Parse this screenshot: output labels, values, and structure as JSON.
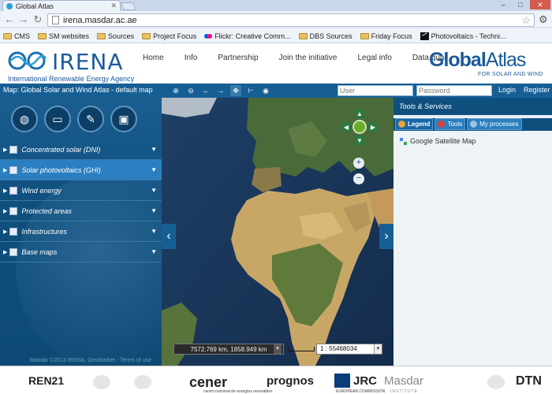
{
  "browser": {
    "tab_title": "Global Atlas",
    "url": "irena.masdar.ac.ae",
    "bookmarks": [
      {
        "label": "CMS",
        "icon": "folder-icon"
      },
      {
        "label": "SM websites",
        "icon": "folder-icon"
      },
      {
        "label": "Sources",
        "icon": "folder-icon"
      },
      {
        "label": "Project Focus",
        "icon": "folder-icon"
      },
      {
        "label": "Flickr: Creative Comm...",
        "icon": "flickr-icon"
      },
      {
        "label": "DBS Sources",
        "icon": "folder-icon"
      },
      {
        "label": "Friday Focus",
        "icon": "folder-icon"
      },
      {
        "label": "Photovoltaics - Techni...",
        "icon": "photovoltaics-icon"
      }
    ]
  },
  "header": {
    "irena_word": "IRENA",
    "irena_sub": "International Renewable Energy Agency",
    "nav": [
      "Home",
      "Info",
      "Partnership",
      "Join the initiative",
      "Legal info",
      "Data quali"
    ],
    "global_word": "Global",
    "atlas_word": "Atlas",
    "ga_sub": "FOR SOLAR AND WIND"
  },
  "appbar": {
    "map_title": "Map: Global Solar and Wind Atlas - default map",
    "user_placeholder": "User",
    "password_placeholder": "Password",
    "login": "Login",
    "register": "Register"
  },
  "left_panel": {
    "buttons": [
      "globe-icon",
      "folder-icon",
      "pencil-icon",
      "save-icon"
    ],
    "layers": [
      {
        "label": "Concentrated solar (DNI)",
        "active": false
      },
      {
        "label": "Solar photovoltaics (GHI)",
        "active": true
      },
      {
        "label": "Wind energy",
        "active": false
      },
      {
        "label": "Protected areas",
        "active": false
      },
      {
        "label": "Infrastructures",
        "active": false
      },
      {
        "label": "Base maps",
        "active": false
      }
    ],
    "copyright": "Masdar ©2013 IRENA, GeoMarket - Terms of use"
  },
  "map": {
    "coordinates": "7572.769 km, 1858.949 km",
    "scale": "1 : 55468034"
  },
  "right_panel": {
    "title": "Tools & Services",
    "tabs": [
      "Legend",
      "Tools",
      "My processes"
    ],
    "legend_item": "Google Satellite Map"
  },
  "footer": {
    "ren21": "REN21",
    "cener": "cener",
    "cener_sub": "centro nacional de energías renovables",
    "prognos": "prognos",
    "jrc": "JRC",
    "jrc_sub": "EUROPEAN COMMISSION",
    "masdar": "Masdar",
    "masdar_sub": "INSTITUTE",
    "dtn": "DTN"
  }
}
